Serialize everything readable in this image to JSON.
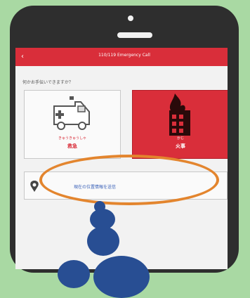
{
  "header": {
    "title": "110/119 Emergency Call"
  },
  "prompt": "何かお手伝いできますか？",
  "cards": {
    "ambulance": {
      "subtitle": "きゅうきゅうしゃ",
      "title": "救急",
      "icon": "ambulance-icon"
    },
    "fire": {
      "subtitle": "かじ",
      "title": "火事",
      "icon": "fire-building-icon"
    }
  },
  "location": {
    "text": "現在の位置情報を送信",
    "icon": "map-pin-icon"
  },
  "colors": {
    "accent": "#d92e3a",
    "highlight": "#e3852e",
    "bubble": "#284e93",
    "background": "#a9d9a3"
  }
}
